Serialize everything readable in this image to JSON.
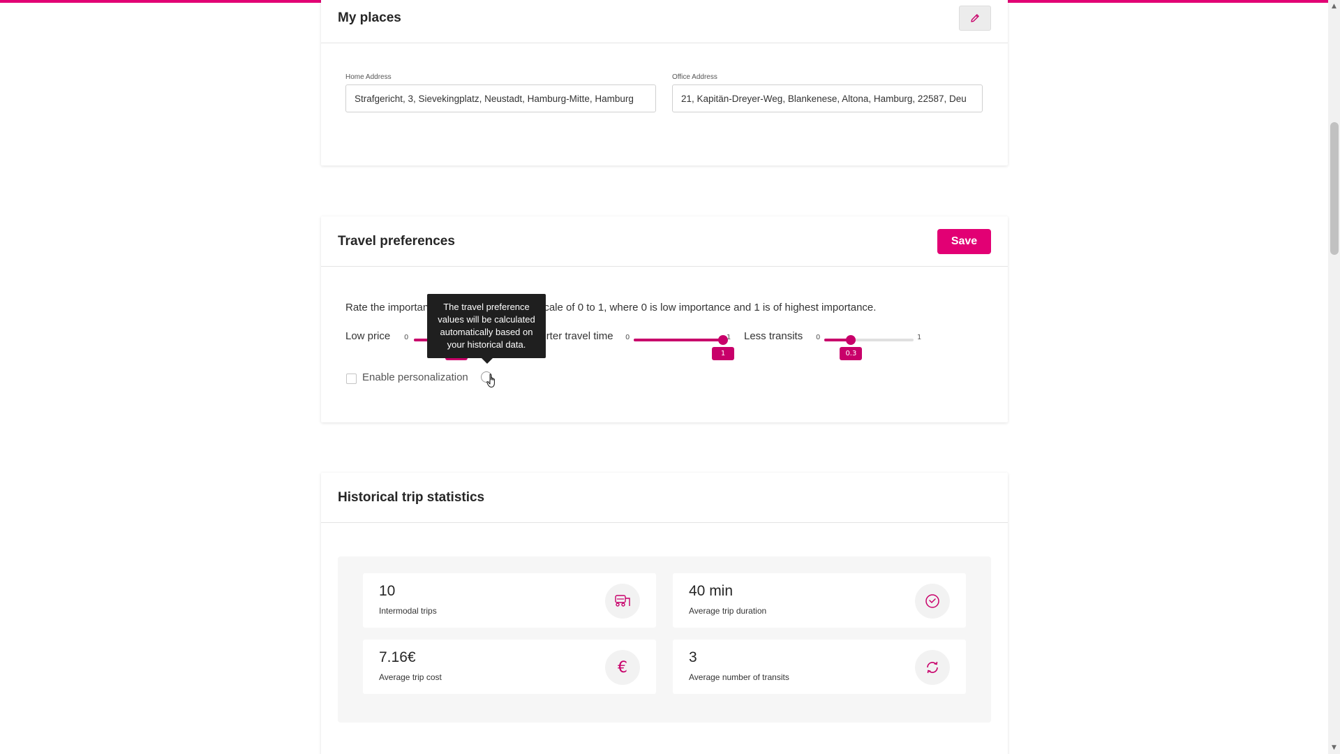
{
  "colors": {
    "accent": "#e20074",
    "slider": "#c8006a",
    "panel": "#f6f6f6"
  },
  "places": {
    "title": "My places",
    "edit_icon": "pencil-icon",
    "home": {
      "label": "Home Address",
      "value": "Strafgericht, 3, Sievekingplatz, Neustadt, Hamburg-Mitte, Hamburg"
    },
    "office": {
      "label": "Office Address",
      "value": "21, Kapitän-Dreyer-Weg, Blankenese, Altona, Hamburg, 22587, Deu"
    }
  },
  "preferences": {
    "title": "Travel preferences",
    "save_label": "Save",
    "description": "Rate the importance of the following on a scale of 0 to 1, where 0 is low importance and 1 is of highest importance.",
    "sliders": [
      {
        "label": "Low price",
        "min": "0",
        "max": "1",
        "value": 0.5,
        "value_label": "0.5"
      },
      {
        "label": "Shorter travel time",
        "min": "0",
        "max": "1",
        "value": 1,
        "value_label": "1"
      },
      {
        "label": "Less transits",
        "min": "0",
        "max": "1",
        "value": 0.3,
        "value_label": "0.3"
      }
    ],
    "personalization_label": "Enable personalization",
    "personalization_checked": false,
    "tooltip": "The travel preference values will be calculated automatically based on your historical data."
  },
  "statistics": {
    "title": "Historical trip statistics",
    "tiles": [
      {
        "value": "10",
        "label": "Intermodal trips",
        "icon": "intermodal-icon"
      },
      {
        "value": "40 min",
        "label": "Average trip duration",
        "icon": "clock-icon"
      },
      {
        "value": "7.16€",
        "label": "Average trip cost",
        "icon": "euro-icon"
      },
      {
        "value": "3",
        "label": "Average number of transits",
        "icon": "refresh-icon"
      }
    ]
  }
}
